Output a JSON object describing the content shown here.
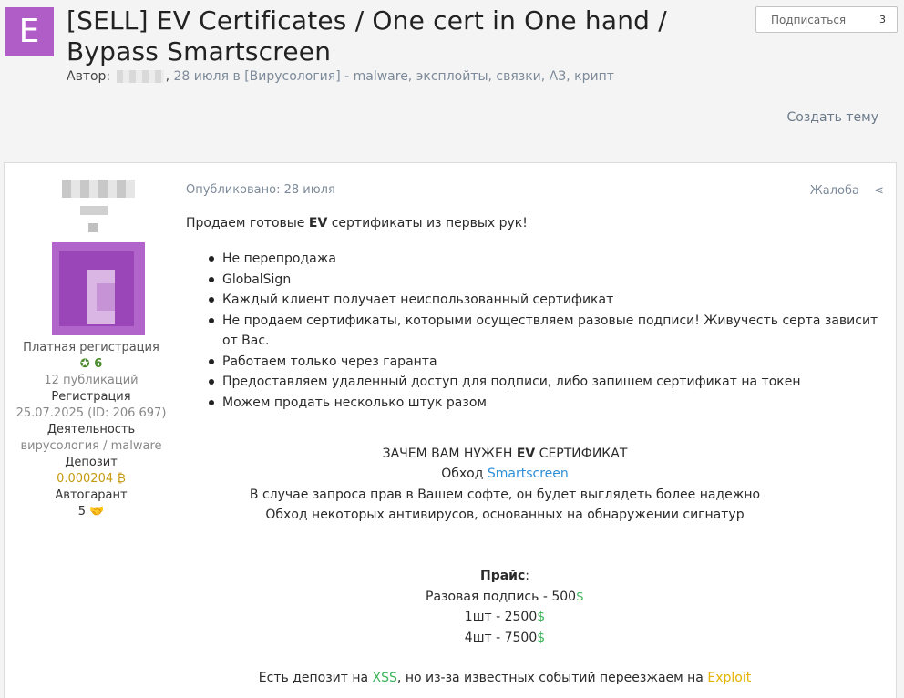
{
  "topic": {
    "avatar_letter": "E",
    "title": "[SELL] EV Certificates / One cert in One hand / Bypass Smartscreen",
    "meta_prefix": "Автор:",
    "meta_date": "28 июля в",
    "meta_forum": "[Вирусология] - malware, эксплойты, связки, АЗ, крипт",
    "follow_label": "Подписаться",
    "follow_count": "3",
    "create_topic": "Создать тему"
  },
  "author": {
    "group": "Платная регистрация",
    "reputation": "6",
    "posts": "12 публикаций",
    "reg_label": "Регистрация",
    "reg_value": "25.07.2025 (ID: 206 697)",
    "activity_label": "Деятельность",
    "activity_value": "вирусология / malware",
    "deposit_label": "Депозит",
    "deposit_value": "0.000204",
    "autogarant_label": "Автогарант",
    "autogarant_value": "5"
  },
  "post": {
    "published": "Опубликовано: 28 июля",
    "report": "Жалоба",
    "intro_pre": "Продаем готовые ",
    "intro_bold": "EV",
    "intro_post": " сертификаты из первых рук!",
    "bullets": [
      "Не перепродажа",
      "GlobalSign",
      "Каждый клиент получает неиспользованный сертификат",
      "Не продаем сертификаты, которыми осуществляем разовые подписи! Живучесть серта зависит от Вас.",
      "Работаем только через гаранта",
      "Предоставляем удаленный доступ для подписи, либо запишем сертификат на токен",
      "Можем продать несколько штук разом"
    ],
    "why_pre": "ЗАЧЕМ ВАМ НУЖЕН ",
    "why_bold": "EV",
    "why_post": " СЕРТИФИКАТ",
    "bypass_pre": "Обход ",
    "bypass_link": "Smartscreen",
    "line_rights": "В случае запроса прав в Вашем софте, он будет выглядеть более надежно",
    "line_av": "Обход некоторых антивирусов, основанных на обнаружении сигнатур",
    "price_title": "Прайс",
    "price_colon": ":",
    "prices": [
      {
        "label": "Разовая подпись - 500",
        "cur": "$"
      },
      {
        "label": "1шт - 2500",
        "cur": "$"
      },
      {
        "label": "4шт - 7500",
        "cur": "$"
      }
    ],
    "deposit_pre": "Есть депозит на ",
    "deposit_xss": "XSS",
    "deposit_mid": ", но из-за известных событий переезжаем на ",
    "deposit_exploit": "Exploit"
  },
  "colors": {
    "accent_green": "#3ab35a",
    "link_blue": "#2f8fd6",
    "exploit_yellow": "#e4b300",
    "avatar_purple": "#b15dc7"
  },
  "icons": {
    "rep": "plus-circle-icon",
    "bitcoin": "bitcoin-icon",
    "handshake": "handshake-icon",
    "share": "share-icon"
  }
}
